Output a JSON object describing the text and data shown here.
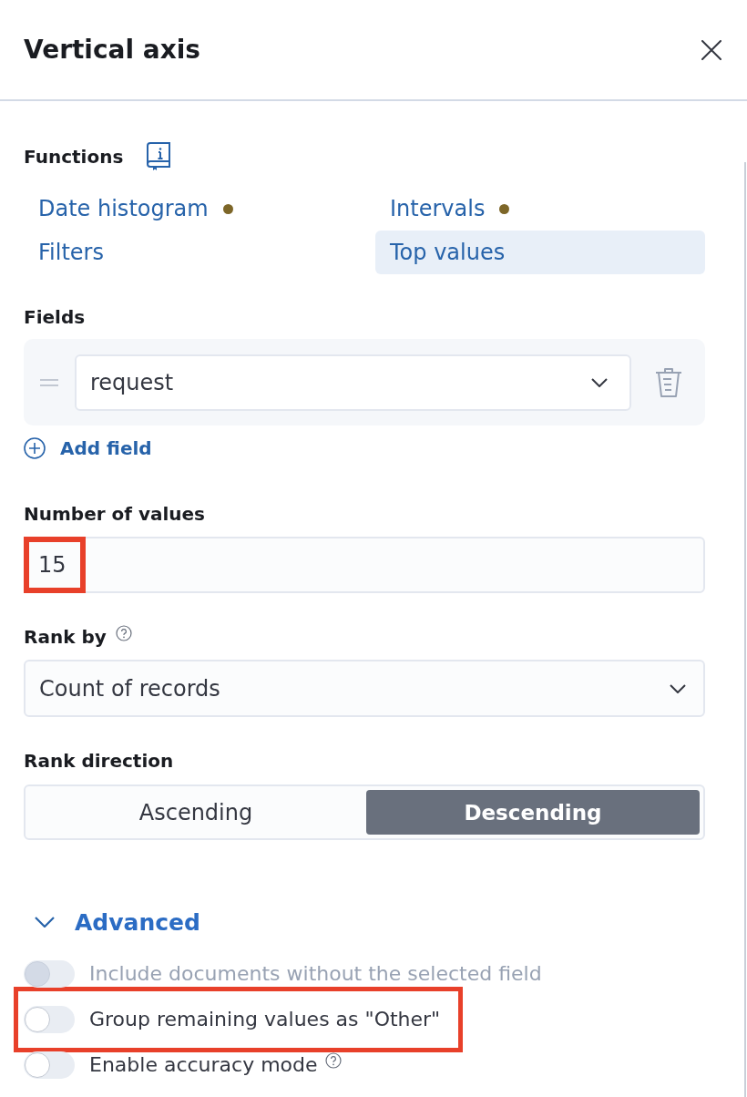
{
  "header": {
    "title": "Vertical axis"
  },
  "functions": {
    "label": "Functions",
    "items": [
      {
        "label": "Date histogram",
        "selected": false,
        "marked": true
      },
      {
        "label": "Intervals",
        "selected": false,
        "marked": true
      },
      {
        "label": "Filters",
        "selected": false,
        "marked": false
      },
      {
        "label": "Top values",
        "selected": true,
        "marked": false
      }
    ]
  },
  "fields": {
    "label": "Fields",
    "items": [
      {
        "value": "request"
      }
    ],
    "add_label": "Add field"
  },
  "number_of_values": {
    "label": "Number of values",
    "value": "15",
    "highlighted": true
  },
  "rank_by": {
    "label": "Rank by",
    "value": "Count of records"
  },
  "rank_direction": {
    "label": "Rank direction",
    "options": [
      {
        "label": "Ascending",
        "selected": false
      },
      {
        "label": "Descending",
        "selected": true
      }
    ]
  },
  "advanced": {
    "label": "Advanced",
    "expanded": true,
    "toggles": [
      {
        "label": "Include documents without the selected field",
        "on": false,
        "disabled": true,
        "highlighted": false,
        "help": false
      },
      {
        "label": "Group remaining values as \"Other\"",
        "on": false,
        "disabled": false,
        "highlighted": true,
        "help": false
      },
      {
        "label": "Enable accuracy mode",
        "on": false,
        "disabled": false,
        "highlighted": false,
        "help": true
      }
    ]
  }
}
